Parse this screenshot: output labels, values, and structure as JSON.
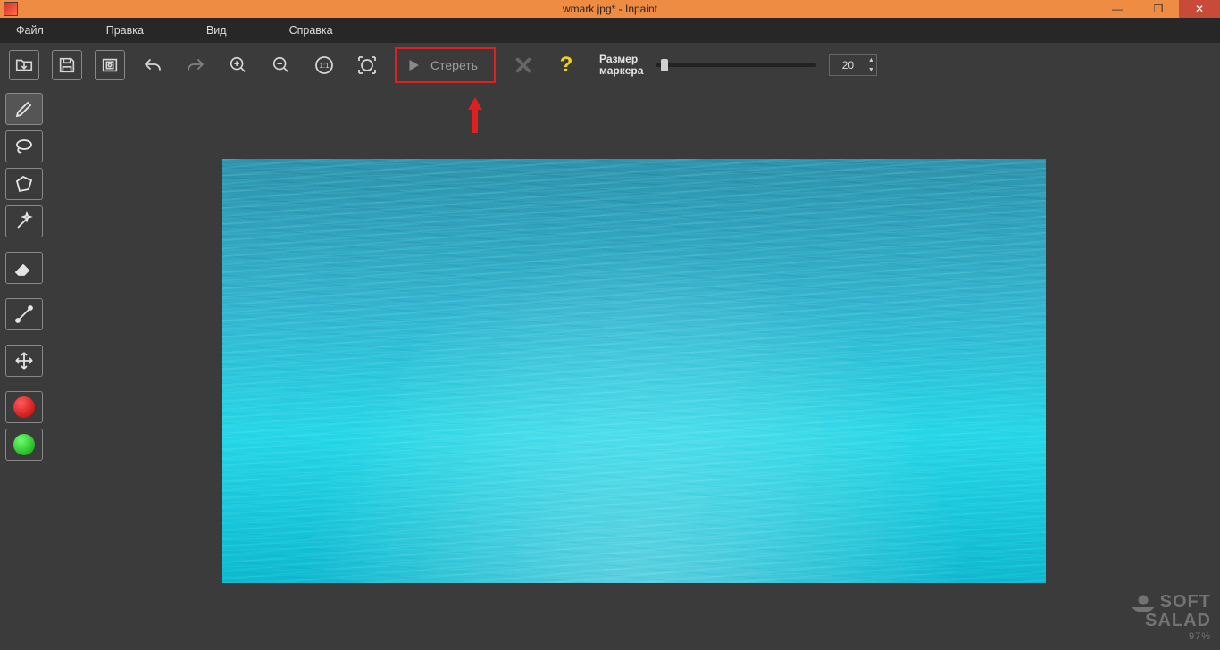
{
  "titlebar": {
    "title": "wmark.jpg* - Inpaint"
  },
  "menu": {
    "items": [
      "Файл",
      "Правка",
      "Вид",
      "Справка"
    ]
  },
  "toolbar": {
    "erase_label": "Стереть",
    "marker_label_line1": "Размер",
    "marker_label_line2": "маркера",
    "marker_value": "20"
  },
  "brand": {
    "line1": "SOFT",
    "line2": "SALAD",
    "percent": "97%"
  }
}
